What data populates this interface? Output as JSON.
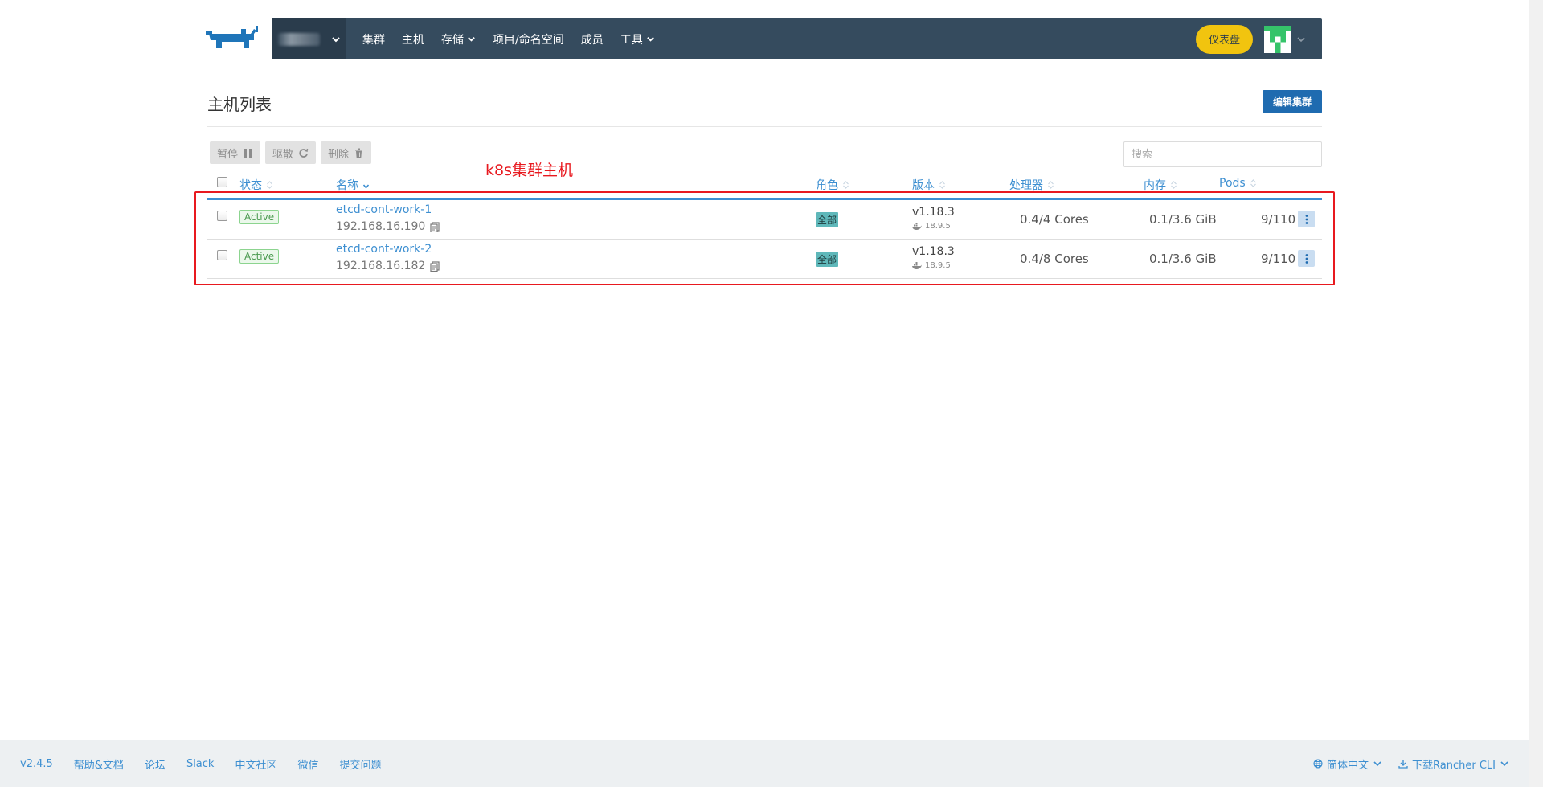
{
  "colors": {
    "navbar": "#354b5e",
    "accent": "#3d8fd1",
    "dashboard": "#f1c40f",
    "annotation": "#e8191f",
    "active_badge": "#4a9a4f",
    "role_badge": "#5fb8ba"
  },
  "nav": {
    "items": [
      {
        "label": "集群",
        "has_dropdown": false
      },
      {
        "label": "主机",
        "has_dropdown": false
      },
      {
        "label": "存储",
        "has_dropdown": true
      },
      {
        "label": "项目/命名空间",
        "has_dropdown": false
      },
      {
        "label": "成员",
        "has_dropdown": false
      },
      {
        "label": "工具",
        "has_dropdown": true
      }
    ],
    "dashboard_label": "仪表盘"
  },
  "page": {
    "title": "主机列表",
    "edit_cluster": "编辑集群"
  },
  "actions": {
    "pause": "暂停",
    "drain": "驱散",
    "delete": "删除"
  },
  "search": {
    "placeholder": "搜索"
  },
  "annotation": {
    "label": "k8s集群主机"
  },
  "table": {
    "columns": {
      "state": "状态",
      "name": "名称",
      "roles": "角色",
      "version": "版本",
      "cpu": "处理器",
      "memory": "内存",
      "pods": "Pods"
    },
    "rows": [
      {
        "state": "Active",
        "name": "etcd-cont-work-1",
        "ip": "192.168.16.190",
        "role": "全部",
        "version": "v1.18.3",
        "docker": "18.9.5",
        "cpu": "0.4/4 Cores",
        "memory": "0.1/3.6 GiB",
        "pods": "9/110"
      },
      {
        "state": "Active",
        "name": "etcd-cont-work-2",
        "ip": "192.168.16.182",
        "role": "全部",
        "version": "v1.18.3",
        "docker": "18.9.5",
        "cpu": "0.4/8 Cores",
        "memory": "0.1/3.6 GiB",
        "pods": "9/110"
      }
    ]
  },
  "footer": {
    "version": "v2.4.5",
    "links": [
      "帮助&文档",
      "论坛",
      "Slack",
      "中文社区",
      "微信",
      "提交问题"
    ],
    "language": "简体中文",
    "download": "下载Rancher CLI"
  }
}
